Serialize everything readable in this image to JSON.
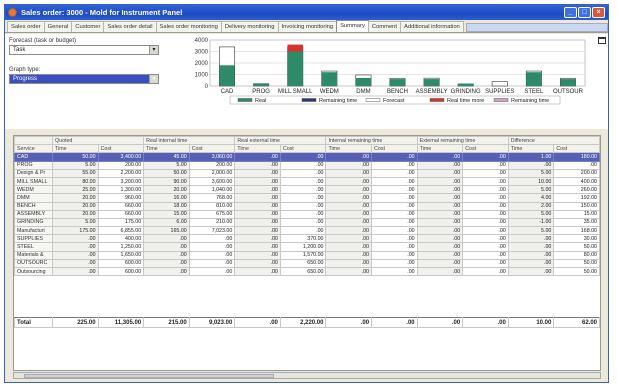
{
  "window": {
    "title": "Sales order: 3000 - Mold for Instrument Panel"
  },
  "tabs": [
    {
      "label": "Sales order"
    },
    {
      "label": "General"
    },
    {
      "label": "Customer"
    },
    {
      "label": "Sales order detail"
    },
    {
      "label": "Sales order monitoring"
    },
    {
      "label": "Delivery monitoring"
    },
    {
      "label": "Invoicing monitoring"
    },
    {
      "label": "Summary",
      "active": true
    },
    {
      "label": "Comment"
    },
    {
      "label": "Additional information"
    }
  ],
  "forecast": {
    "label": "Forecast (task or budget)",
    "value": "Task"
  },
  "graph_type": {
    "label": "Graph type:",
    "value": "Progress"
  },
  "chart_data": {
    "type": "bar",
    "categories": [
      "CAD",
      "PROG",
      "MILL SMALL",
      "WEDM",
      "DMM",
      "BENCH",
      "ASSEMBLY",
      "GRINDING",
      "SUPPLIES",
      "STEEL",
      "OUTSOUR"
    ],
    "yticks": [
      "4000",
      "3000",
      "2000",
      "1000",
      "0"
    ],
    "ylim": [
      0,
      4000
    ],
    "series": [
      {
        "name": "Real",
        "color": "#2e8b6a",
        "values": [
          1800,
          200,
          3000,
          1200,
          700,
          600,
          600,
          200,
          0,
          1200,
          600
        ]
      },
      {
        "name": "Remaining time",
        "color": "#2a3d6e",
        "values": [
          0,
          0,
          0,
          0,
          0,
          0,
          0,
          0,
          0,
          0,
          0
        ]
      },
      {
        "name": "Forecast",
        "color": "#ffffff",
        "values": [
          3400,
          200,
          3400,
          1300,
          960,
          660,
          680,
          180,
          380,
          1300,
          650
        ]
      },
      {
        "name": "Real time more",
        "color": "#d8322a",
        "values": [
          0,
          0,
          600,
          0,
          0,
          0,
          0,
          0,
          0,
          0,
          0
        ]
      },
      {
        "name": "Remaining time",
        "color": "#d6a0c0",
        "values": [
          0,
          0,
          0,
          0,
          0,
          0,
          0,
          0,
          0,
          0,
          0
        ]
      }
    ]
  },
  "table": {
    "group_headers": [
      "Quoted",
      "Real internal time",
      "Real external time",
      "Internal remaining time",
      "External remaining time",
      "Difference"
    ],
    "sub_headers": [
      "Service",
      "Time",
      "Cost",
      "Time",
      "Cost",
      "Time",
      "Cost",
      "Time",
      "Cost",
      "Time",
      "Cost",
      "Time",
      "Cost"
    ],
    "rows": [
      {
        "name": "CAD",
        "selected": true,
        "cells": [
          "50.00",
          "3,400.00",
          "45.00",
          "3,060.00",
          ".00",
          ".00",
          ".00",
          ".00",
          ".00",
          ".00",
          "1.00",
          "180.00"
        ]
      },
      {
        "name": "PROG",
        "cells": [
          "5.00",
          "200.00",
          "5.00",
          "200.00",
          ".00",
          ".00",
          ".00",
          ".00",
          ".00",
          ".00",
          ".00",
          ".00"
        ]
      },
      {
        "name": "Design & Pr",
        "cells": [
          "55.00",
          "2,200.00",
          "50.00",
          "2,000.00",
          ".00",
          ".00",
          ".00",
          ".00",
          ".00",
          ".00",
          "5.00",
          "200.00"
        ]
      },
      {
        "name": "MILL SMALL",
        "cells": [
          "80.00",
          "3,200.00",
          "90.00",
          "3,600.00",
          ".00",
          ".00",
          ".00",
          ".00",
          ".00",
          ".00",
          "10.00",
          "400.00"
        ]
      },
      {
        "name": "WEDM",
        "cells": [
          "25.00",
          "1,300.00",
          "20.00",
          "1,040.00",
          ".00",
          ".00",
          ".00",
          ".00",
          ".00",
          ".00",
          "5.00",
          "260.00"
        ]
      },
      {
        "name": "DMM",
        "cells": [
          "20.00",
          "960.00",
          "16.00",
          "768.00",
          ".00",
          ".00",
          ".00",
          ".00",
          ".00",
          ".00",
          "4.00",
          "192.00"
        ]
      },
      {
        "name": "BENCH",
        "cells": [
          "20.00",
          "660.00",
          "18.00",
          "810.00",
          ".00",
          ".00",
          ".00",
          ".00",
          ".00",
          ".00",
          "2.00",
          "150.00"
        ]
      },
      {
        "name": "ASSEMBLY",
        "cells": [
          "20.00",
          "660.00",
          "15.00",
          "675.00",
          ".00",
          ".00",
          ".00",
          ".00",
          ".00",
          ".00",
          "5.00",
          "15.00"
        ]
      },
      {
        "name": "GRINDING",
        "cells": [
          "5.00",
          "175.00",
          "6.00",
          "210.00",
          ".00",
          ".00",
          ".00",
          ".00",
          ".00",
          ".00",
          "-1.00",
          "35.00"
        ]
      },
      {
        "name": "Manufacturi",
        "cells": [
          "175.00",
          "6,855.00",
          "165.00",
          "7,023.00",
          ".00",
          ".00",
          ".00",
          ".00",
          ".00",
          ".00",
          "5.00",
          "168.00"
        ]
      },
      {
        "name": "SUPPLIES",
        "cells": [
          ".00",
          "400.00",
          ".00",
          ".00",
          ".00",
          "370.00",
          ".00",
          ".00",
          ".00",
          ".00",
          ".00",
          "30.00"
        ]
      },
      {
        "name": "STEEL",
        "cells": [
          ".00",
          "1,250.00",
          ".00",
          ".00",
          ".00",
          "1,200.00",
          ".00",
          ".00",
          ".00",
          ".00",
          ".00",
          "50.00"
        ]
      },
      {
        "name": "Materials & ",
        "cells": [
          ".00",
          "1,650.00",
          ".00",
          ".00",
          ".00",
          "1,570.00",
          ".00",
          ".00",
          ".00",
          ".00",
          ".00",
          "80.00"
        ]
      },
      {
        "name": "OUTSOURC",
        "cells": [
          ".00",
          "600.00",
          ".00",
          ".00",
          ".00",
          "650.00",
          ".00",
          ".00",
          ".00",
          ".00",
          ".00",
          "50.00"
        ]
      },
      {
        "name": "Outsourcing",
        "cells": [
          ".00",
          "600.00",
          ".00",
          ".00",
          ".00",
          "650.00",
          ".00",
          ".00",
          ".00",
          ".00",
          ".00",
          "50.00"
        ]
      }
    ],
    "total": {
      "label": "Total",
      "cells": [
        "225.00",
        "11,305.00",
        "215.00",
        "9,023.00",
        ".00",
        "2,220.00",
        ".00",
        ".00",
        ".00",
        ".00",
        "10.00",
        "62.00"
      ]
    }
  }
}
